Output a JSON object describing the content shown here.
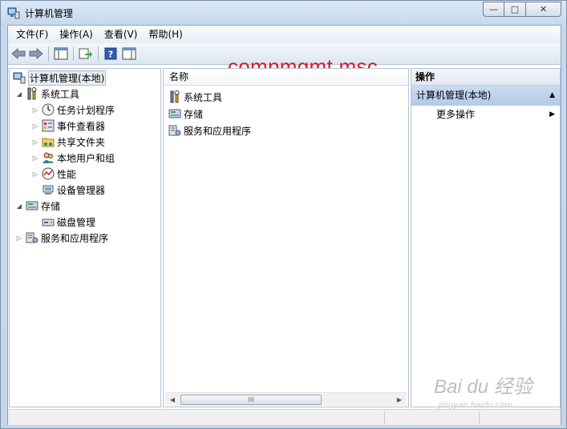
{
  "window": {
    "title": "计算机管理",
    "controls": {
      "minimize": "—",
      "maximize": "□",
      "close": "✕"
    }
  },
  "menu": [
    "文件(F)",
    "操作(A)",
    "查看(V)",
    "帮助(H)"
  ],
  "overlay_text": "compmgmt.msc",
  "tree": {
    "root": "计算机管理(本地)",
    "items": [
      {
        "label": "系统工具",
        "expanded": true
      },
      {
        "label": "任务计划程序"
      },
      {
        "label": "事件查看器"
      },
      {
        "label": "共享文件夹"
      },
      {
        "label": "本地用户和组"
      },
      {
        "label": "性能"
      },
      {
        "label": "设备管理器"
      },
      {
        "label": "存储",
        "expanded": true
      },
      {
        "label": "磁盘管理"
      },
      {
        "label": "服务和应用程序"
      }
    ]
  },
  "list": {
    "header": "名称",
    "rows": [
      "系统工具",
      "存储",
      "服务和应用程序"
    ],
    "scroll_thumb": "III"
  },
  "actions": {
    "header": "操作",
    "section": "计算机管理(本地)",
    "item": "更多操作"
  },
  "watermark": {
    "main": "Bai du 经验",
    "sub": "jingyan.baidu.com"
  },
  "colors": {
    "overlay": "#e8141b",
    "selection": "#b3c9e6"
  }
}
